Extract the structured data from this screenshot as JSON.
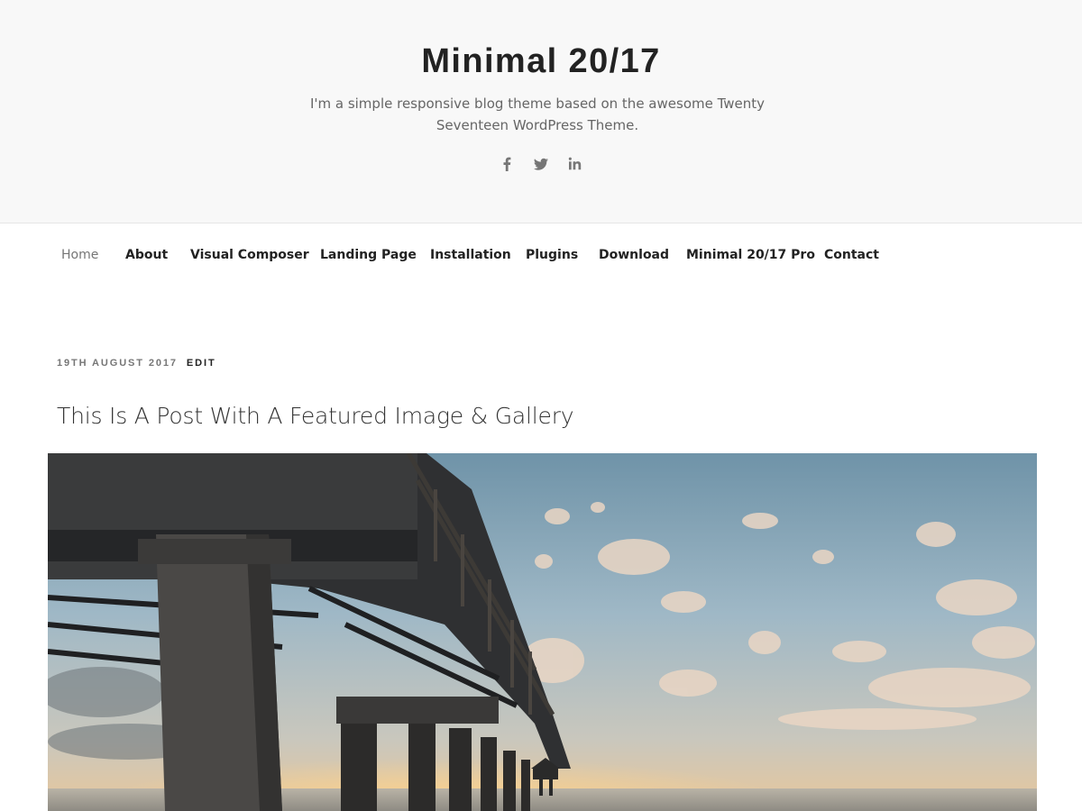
{
  "site": {
    "title": "Minimal 20/17",
    "description": "I'm a simple responsive blog theme based on the awesome Twenty Seventeen WordPress Theme."
  },
  "social": [
    {
      "name": "facebook",
      "icon": "facebook-icon"
    },
    {
      "name": "twitter",
      "icon": "twitter-icon"
    },
    {
      "name": "linkedin",
      "icon": "linkedin-icon"
    }
  ],
  "nav": {
    "items": [
      {
        "label": "Home",
        "current": true
      },
      {
        "label": "About"
      },
      {
        "label": "Visual Composer"
      },
      {
        "label": "Landing Page"
      },
      {
        "label": "Installation"
      },
      {
        "label": "Plugins"
      },
      {
        "label": "Download"
      },
      {
        "label": "Minimal 20/17 Pro"
      },
      {
        "label": "Contact"
      }
    ]
  },
  "post": {
    "date": "19th August 2017",
    "edit_label": "Edit",
    "title": "This Is A Post With A Featured Image & Gallery",
    "featured_image": "pier-at-sunset-photo"
  },
  "colors": {
    "header_bg": "#f8f8f8",
    "text": "#222222",
    "muted": "#767676",
    "icon": "#767676"
  }
}
